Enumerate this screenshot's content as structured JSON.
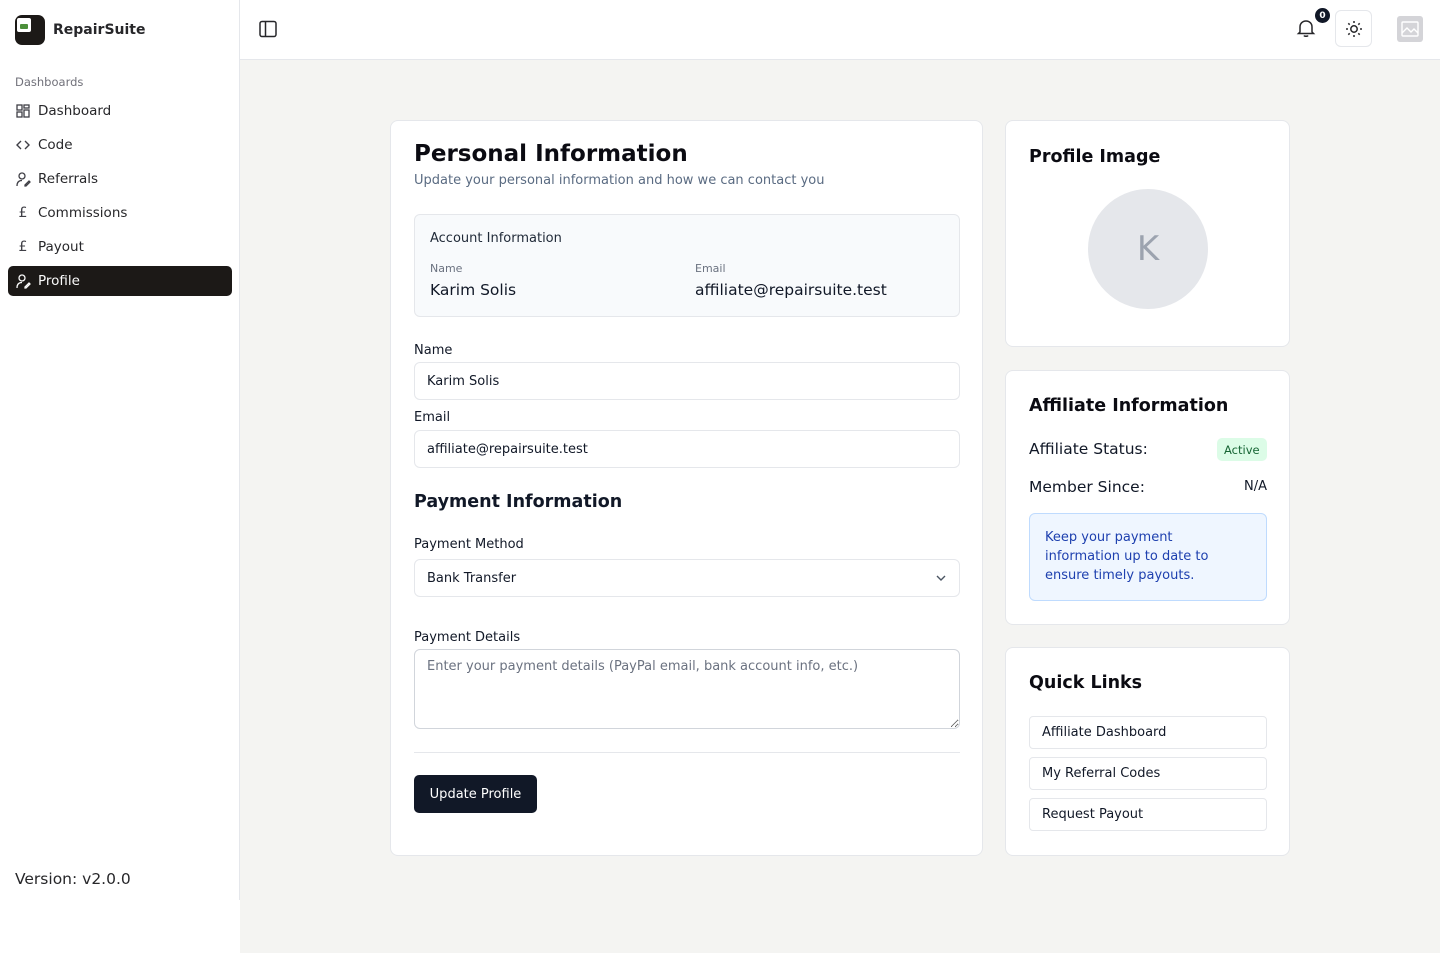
{
  "app": {
    "name": "RepairSuite",
    "version": "Version: v2.0.0"
  },
  "sidebar": {
    "group_label": "Dashboards",
    "items": [
      {
        "label": "Dashboard",
        "icon": "grid-icon"
      },
      {
        "label": "Code",
        "icon": "code-icon"
      },
      {
        "label": "Referrals",
        "icon": "user-pen-icon"
      },
      {
        "label": "Commissions",
        "icon": "pound-icon"
      },
      {
        "label": "Payout",
        "icon": "pound-icon"
      },
      {
        "label": "Profile",
        "icon": "user-pen-icon",
        "active": true
      }
    ]
  },
  "header": {
    "notification_count": "0"
  },
  "personal": {
    "title": "Personal Information",
    "subtitle": "Update your personal information and how we can contact you",
    "account_box": {
      "title": "Account Information",
      "name_label": "Name",
      "name_value": "Karim Solis",
      "email_label": "Email",
      "email_value": "affiliate@repairsuite.test"
    },
    "name_label": "Name",
    "name_value": "Karim Solis",
    "email_label": "Email",
    "email_value": "affiliate@repairsuite.test",
    "payment_section": "Payment Information",
    "payment_method_label": "Payment Method",
    "payment_method_value": "Bank Transfer",
    "payment_details_label": "Payment Details",
    "payment_details_placeholder": "Enter your payment details (PayPal email, bank account info, etc.)",
    "submit_label": "Update Profile"
  },
  "profile_image": {
    "title": "Profile Image",
    "initial": "K"
  },
  "affiliate": {
    "title": "Affiliate Information",
    "status_label": "Affiliate Status:",
    "status_value": "Active",
    "member_label": "Member Since:",
    "member_value": "N/A",
    "note": "Keep your payment information up to date to ensure timely payouts."
  },
  "quick_links": {
    "title": "Quick Links",
    "items": [
      "Affiliate Dashboard",
      "My Referral Codes",
      "Request Payout"
    ]
  },
  "colors": {
    "primary": "#111827",
    "sidebar_active": "#1c1917",
    "success_bg": "#dcfce7",
    "info_bg": "#eff6ff"
  }
}
